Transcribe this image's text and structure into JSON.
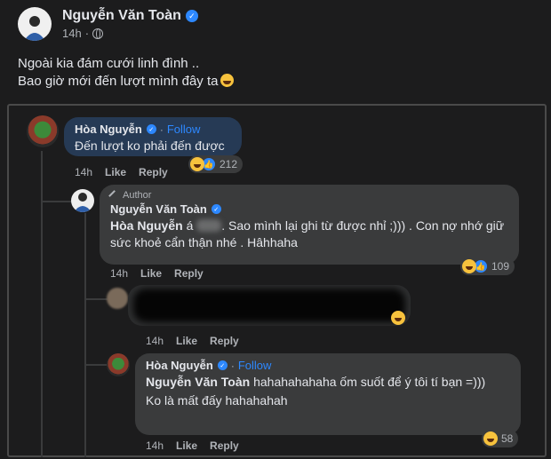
{
  "post": {
    "author": "Nguyễn Văn Toàn",
    "time": "14h",
    "dot": "·",
    "verified_icon": "✓",
    "line1": "Ngoài kia đám cưới linh đình ..",
    "line2": "Bao giờ mới đến lượt mình đây ta"
  },
  "comments": {
    "c1": {
      "name": "Hòa Nguyễn",
      "follow": "Follow",
      "sep": "·",
      "text": "Đến lượt ko phải đến được",
      "time": "14h",
      "like": "Like",
      "reply": "Reply",
      "reactions": "212"
    },
    "c2": {
      "author_tag": "Author",
      "name": "Nguyễn Văn Toàn",
      "mention": "Hòa Nguyễn",
      "mention_suffix": "á",
      "text_rest": ". Sao mình lại ghi từ được nhỉ ;))) . Con nợ nhớ giữ sức khoẻ cẩn thận nhé . Hâhhaha",
      "time": "14h",
      "like": "Like",
      "reply": "Reply",
      "reactions": "109"
    },
    "c3": {
      "time": "14h",
      "like": "Like",
      "reply": "Reply"
    },
    "c4": {
      "name": "Hòa Nguyễn",
      "follow": "Follow",
      "sep": "·",
      "mention": "Nguyễn Văn Toàn",
      "text1": "hahahahahaha ốm suốt để ý tôi tí bạn =)))",
      "text2": "Ko là mất đấy hahahahah",
      "time": "14h",
      "like": "Like",
      "reply": "Reply",
      "reactions": "58"
    }
  },
  "colors": {
    "background": "#1c1c1d",
    "bubble": "#3a3b3c",
    "highlight_bubble": "#263a55",
    "link": "#2d88ff"
  }
}
